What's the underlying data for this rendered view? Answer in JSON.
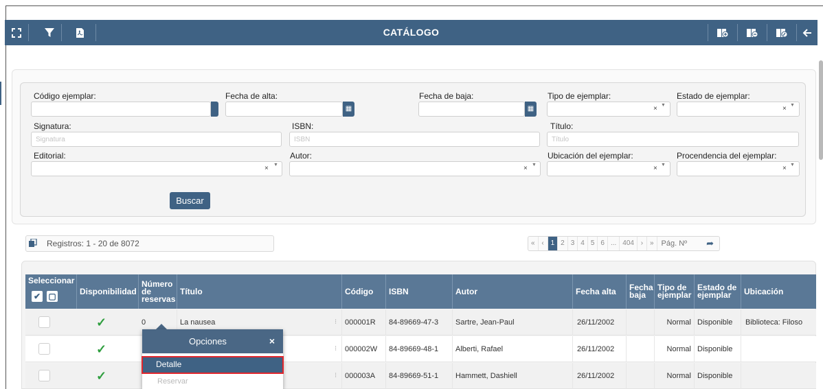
{
  "toolbar": {
    "title": "CATÁLOGO",
    "left_icons": [
      "expand-icon",
      "filter-icon",
      "pdf-icon"
    ],
    "right_icons": [
      "book-add-icon",
      "book-remove-icon",
      "book-edit-icon",
      "back-arrow-icon"
    ]
  },
  "filters": {
    "codigo_ejemplar": {
      "label": "Código ejemplar:",
      "value": ""
    },
    "fecha_alta": {
      "label": "Fecha de alta:",
      "value": ""
    },
    "fecha_baja": {
      "label": "Fecha de baja:",
      "value": ""
    },
    "tipo_ejemplar": {
      "label": "Tipo de ejemplar:",
      "value": ""
    },
    "estado_ejemplar": {
      "label": "Estado de ejemplar:",
      "value": ""
    },
    "signatura": {
      "label": "Signatura:",
      "placeholder": "Signatura"
    },
    "isbn": {
      "label": "ISBN:",
      "placeholder": "ISBN"
    },
    "titulo": {
      "label": "Título:",
      "placeholder": "Título"
    },
    "editorial": {
      "label": "Editorial:",
      "value": ""
    },
    "autor": {
      "label": "Autor:",
      "value": ""
    },
    "ubicacion": {
      "label": "Ubicación del ejemplar:",
      "value": ""
    },
    "procedencia": {
      "label": "Procendencia del ejemplar:",
      "value": ""
    },
    "clear_symbol": "×",
    "search_button": "Buscar"
  },
  "records": {
    "label": "Registros: 1 - 20 de 8072"
  },
  "pagination": {
    "first": "«",
    "prev": "‹",
    "pages": [
      "1",
      "2",
      "3",
      "4",
      "5",
      "6",
      "...",
      "404"
    ],
    "active_page": "1",
    "next": "›",
    "last": "»",
    "page_input_placeholder": "Pág. Nº"
  },
  "table": {
    "headers": {
      "seleccionar": "Seleccionar",
      "disponibilidad": "Disponibilidad",
      "num_reservas_1": "Número",
      "num_reservas_2": "de",
      "num_reservas_3": "reservas",
      "titulo": "Título",
      "codigo": "Código",
      "isbn": "ISBN",
      "autor": "Autor",
      "fecha_alta": "Fecha alta",
      "fecha_baja_1": "Fecha",
      "fecha_baja_2": "baja",
      "tipo_1": "Tipo de",
      "tipo_2": "ejemplar",
      "estado_1": "Estado de",
      "estado_2": "ejemplar",
      "ubicacion": "Ubicación"
    },
    "rows": [
      {
        "reservas": "0",
        "titulo": "La nausea",
        "codigo": "000001R",
        "isbn": "84-89669-47-3",
        "autor": "Sartre, Jean-Paul",
        "fecha_alta": "26/11/2002",
        "fecha_baja": "",
        "tipo": "Normal",
        "estado": "Disponible",
        "ubicacion": "Biblioteca: Filoso"
      },
      {
        "reservas": "",
        "titulo": "",
        "codigo": "000002W",
        "isbn": "84-89669-48-1",
        "autor": "Alberti, Rafael",
        "fecha_alta": "26/11/2002",
        "fecha_baja": "",
        "tipo": "Normal",
        "estado": "Disponible",
        "ubicacion": ""
      },
      {
        "reservas": "",
        "titulo": "",
        "codigo": "000003A",
        "isbn": "84-89669-51-1",
        "autor": "Hammett, Dashiell",
        "fecha_alta": "26/11/2002",
        "fecha_baja": "",
        "tipo": "Normal",
        "estado": "Disponible",
        "ubicacion": ""
      }
    ]
  },
  "popup": {
    "title": "Opciones",
    "close": "×",
    "items": [
      "Detalle",
      "Reservar"
    ]
  },
  "colors": {
    "primary": "#3f6284",
    "header": "#5a7896",
    "available": "#2e9e3e",
    "highlight": "#e3262c"
  }
}
